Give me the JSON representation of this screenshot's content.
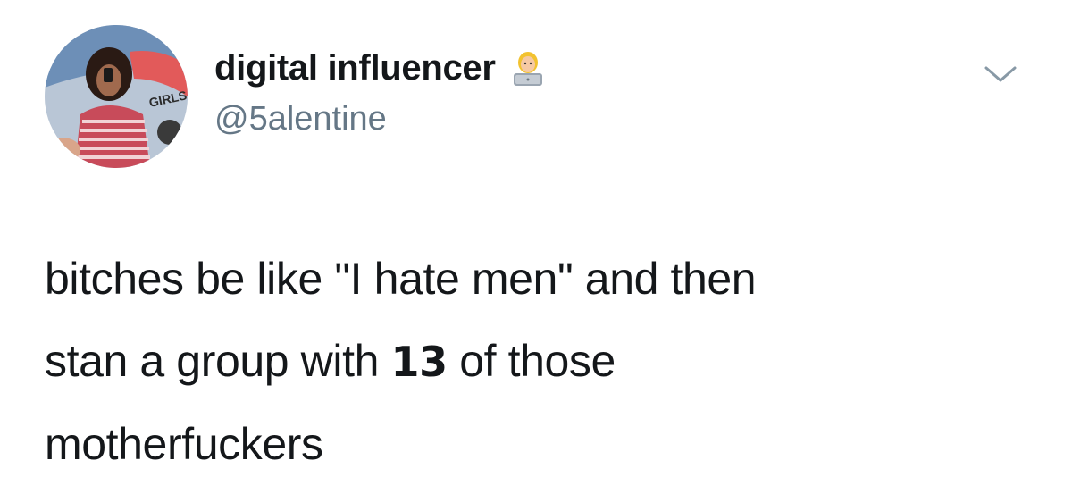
{
  "tweet": {
    "display_name": "digital influencer",
    "handle": "@5alentine",
    "name_emoji": "technologist-emoji",
    "avatar_text": "GIRLS",
    "text_line1": "bitches be like \"I hate men\" and then",
    "text_line2_before": "stan a group with ",
    "text_line2_number": "13",
    "text_line2_after": " of those",
    "text_line3": "motherfuckers"
  },
  "icons": {
    "more_menu": "chevron-down-icon"
  },
  "colors": {
    "text_primary": "#14171a",
    "text_secondary": "#657786",
    "chevron": "#8899a6"
  }
}
